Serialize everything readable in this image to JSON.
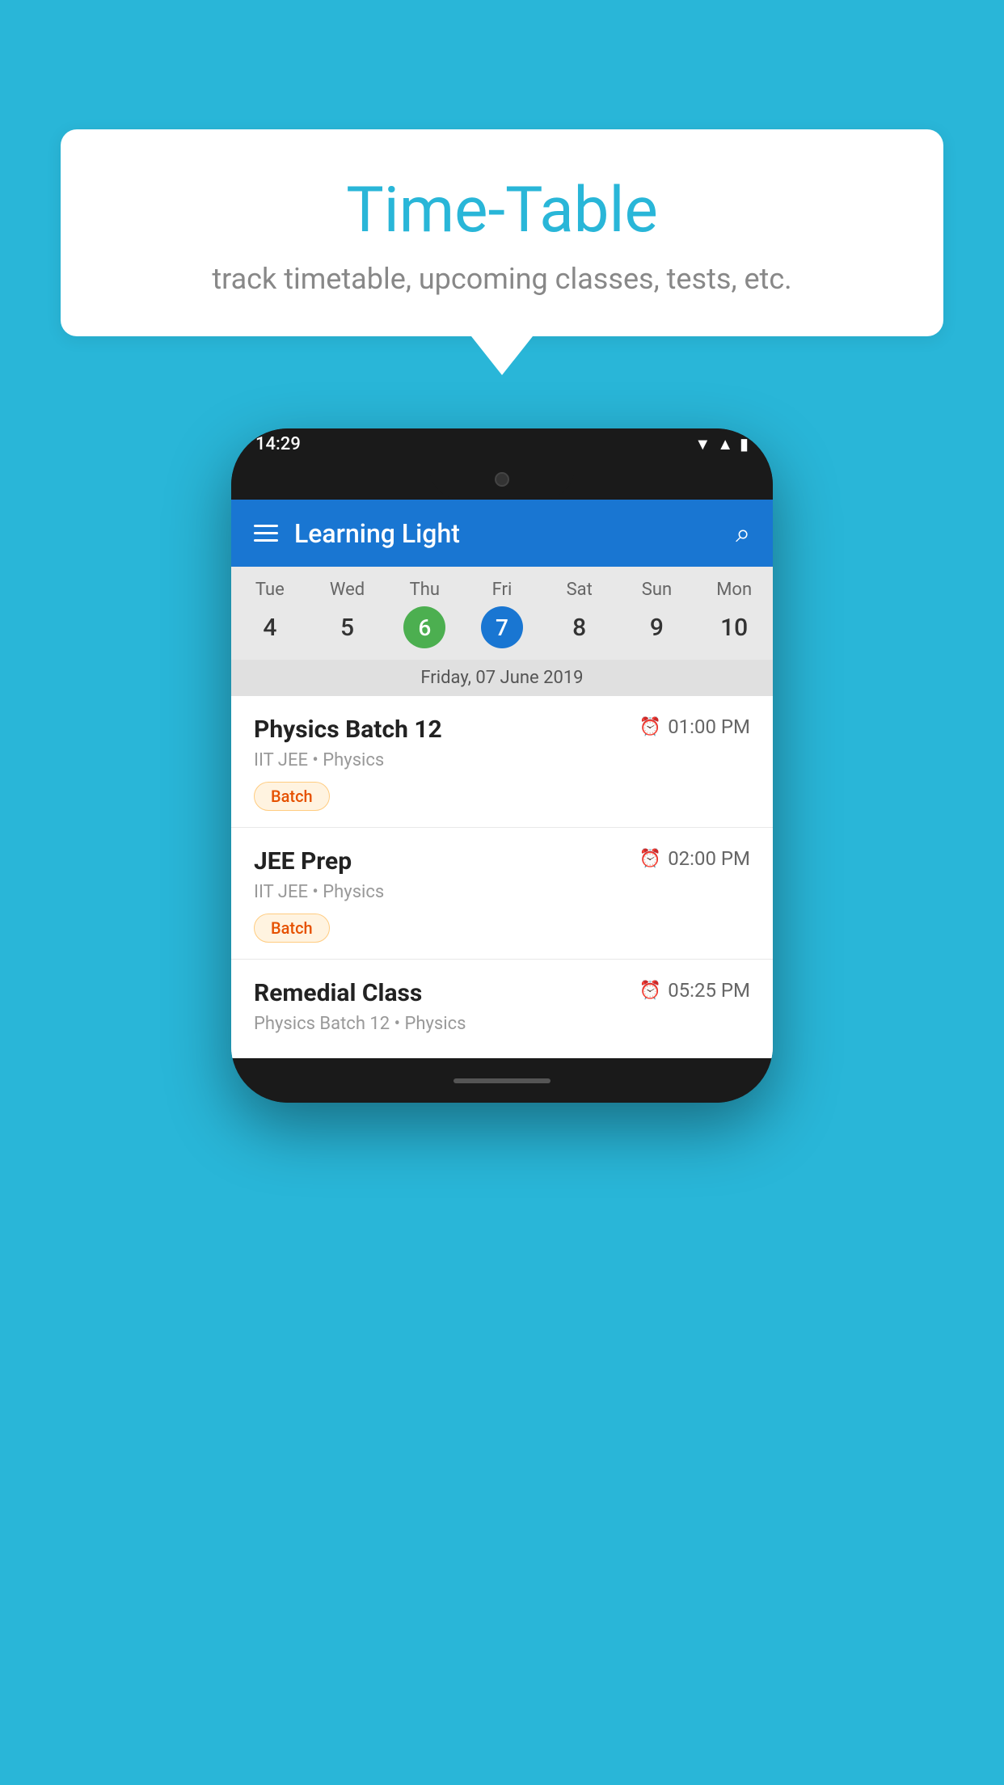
{
  "background_color": "#29B6D8",
  "bubble": {
    "title": "Time-Table",
    "subtitle": "track timetable, upcoming classes, tests, etc."
  },
  "phone": {
    "status_time": "14:29",
    "app_title": "Learning Light",
    "calendar": {
      "days": [
        {
          "label": "Tue",
          "num": "4"
        },
        {
          "label": "Wed",
          "num": "5"
        },
        {
          "label": "Thu",
          "num": "6",
          "style": "today"
        },
        {
          "label": "Fri",
          "num": "7",
          "style": "selected"
        },
        {
          "label": "Sat",
          "num": "8"
        },
        {
          "label": "Sun",
          "num": "9"
        },
        {
          "label": "Mon",
          "num": "10"
        }
      ],
      "selected_date": "Friday, 07 June 2019"
    },
    "classes": [
      {
        "name": "Physics Batch 12",
        "time": "01:00 PM",
        "meta": "IIT JEE • Physics",
        "tag": "Batch"
      },
      {
        "name": "JEE Prep",
        "time": "02:00 PM",
        "meta": "IIT JEE • Physics",
        "tag": "Batch"
      },
      {
        "name": "Remedial Class",
        "time": "05:25 PM",
        "meta": "Physics Batch 12 • Physics",
        "tag": null
      }
    ]
  }
}
